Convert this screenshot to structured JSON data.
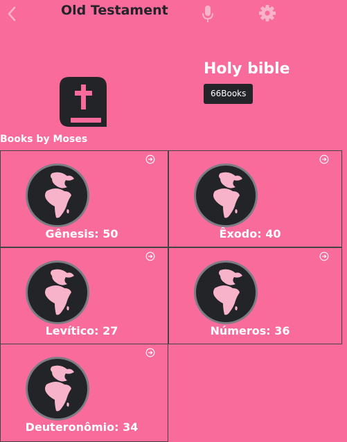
{
  "header": {
    "title": "Old Testament",
    "back_icon": "chevron-left-icon",
    "mic_icon": "microphone-icon",
    "settings_icon": "gear-icon"
  },
  "hero": {
    "title": "Holy bible",
    "badge": "66Books",
    "logo_icon": "bible-cross-icon"
  },
  "section": {
    "title": "Books by Moses"
  },
  "books": [
    {
      "label": "Gênesis: 50",
      "icon": "globe-icon"
    },
    {
      "label": "Êxodo: 40",
      "icon": "globe-icon"
    },
    {
      "label": "Levítico: 27",
      "icon": "globe-icon"
    },
    {
      "label": "Números: 36",
      "icon": "globe-icon"
    },
    {
      "label": "Deuteronômio: 34",
      "icon": "globe-icon"
    }
  ],
  "colors": {
    "background": "#f86b9b",
    "dark": "#222428",
    "icon_light": "#f7b3ca",
    "ring": "#7c7c84"
  }
}
